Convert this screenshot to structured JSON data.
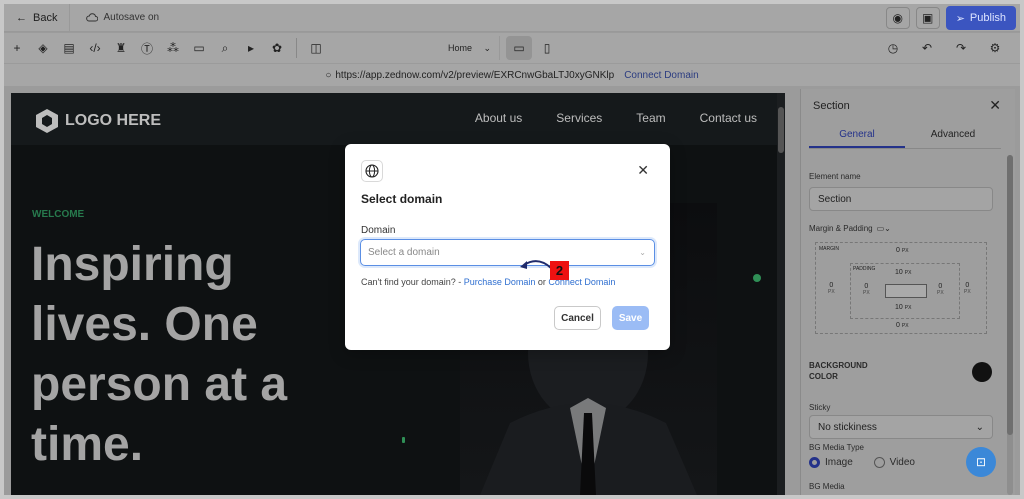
{
  "topbar": {
    "back_label": "Back",
    "autosave_label": "Autosave on",
    "publish_label": "Publish"
  },
  "toolbar": {
    "page_select": "Home"
  },
  "urlbar": {
    "url": "https://app.zednow.com/v2/preview/EXRCnwGbaLTJ0xyGNKlp",
    "connect_label": "Connect Domain"
  },
  "site": {
    "logo_text": "LOGO HERE",
    "nav": [
      "About us",
      "Services",
      "Team",
      "Contact us"
    ],
    "welcome": "WELCOME",
    "headline": [
      "Inspiring",
      "lives. One",
      "person at a",
      "time."
    ]
  },
  "panel": {
    "title": "Section",
    "tabs": [
      "General",
      "Advanced"
    ],
    "element_name_label": "Element name",
    "element_name_value": "Section",
    "margin_padding_label": "Margin & Padding",
    "margin_label": "MARGIN",
    "padding_label": "PADDING",
    "unit": "PX",
    "margin": {
      "top": "0",
      "right": "0",
      "bottom": "0",
      "left": "0"
    },
    "padding": {
      "top": "10",
      "right": "0",
      "bottom": "10",
      "left": "0"
    },
    "bg_color_label": "BACKGROUND COLOR",
    "sticky_label": "Sticky",
    "sticky_value": "No stickiness",
    "bg_media_type_label": "BG Media Type",
    "media_options": [
      "Image",
      "Video"
    ],
    "bg_media_label": "BG Media"
  },
  "modal": {
    "title": "Select domain",
    "domain_label": "Domain",
    "select_placeholder": "Select a domain",
    "help_text": "Can't find your domain? -",
    "purchase_link": "Purchase Domain",
    "or_text": "or",
    "connect_link": "Connect Domain",
    "cancel_label": "Cancel",
    "save_label": "Save"
  },
  "annotation": {
    "step_number": "2"
  },
  "colors": {
    "accent": "#3b55c0",
    "link": "#2f6fd0",
    "welcome_green": "#277a4d",
    "step_badge": "#ee1111"
  }
}
